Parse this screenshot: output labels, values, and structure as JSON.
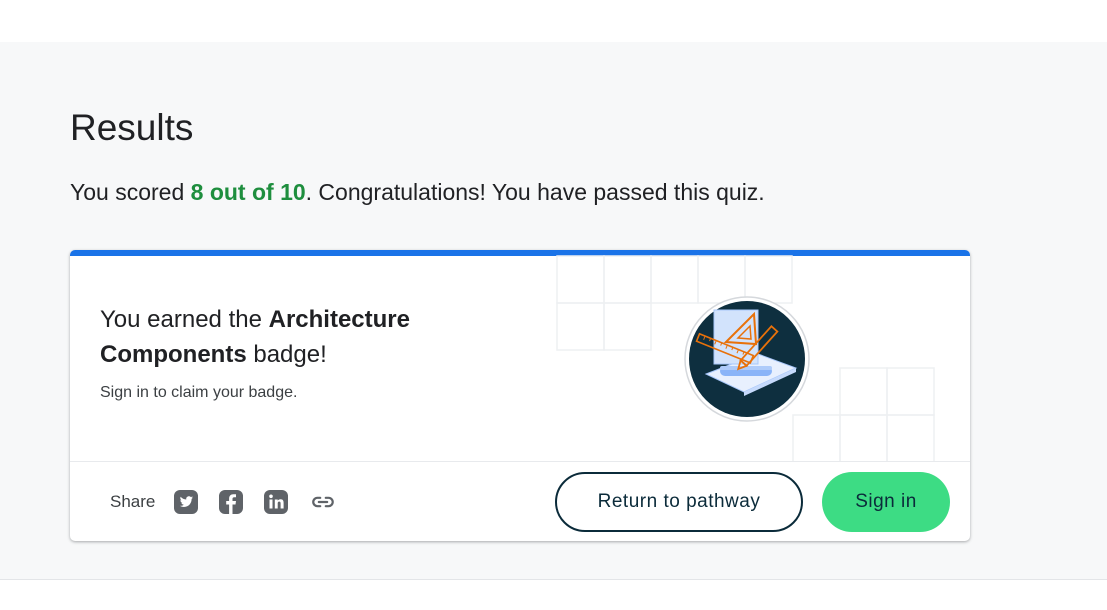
{
  "results": {
    "title": "Results",
    "score_prefix": "You scored ",
    "score_value": "8 out of 10",
    "score_suffix": ". Congratulations! You have passed this quiz."
  },
  "badge_card": {
    "earned_prefix": "You earned the ",
    "badge_name": "Architecture Components",
    "earned_suffix": " badge!",
    "signin_note": "Sign in to claim your badge.",
    "badge_icon": "architecture-components-badge-icon",
    "accent_color": "#1a73e8"
  },
  "footer": {
    "share_label": "Share",
    "social": [
      "twitter-icon",
      "facebook-icon",
      "linkedin-icon",
      "link-icon"
    ],
    "return_button": "Return to pathway",
    "signin_button": "Sign in",
    "signin_color": "#3ddc84"
  }
}
